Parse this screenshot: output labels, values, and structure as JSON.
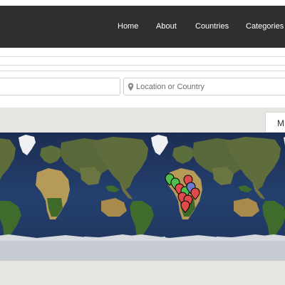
{
  "nav": {
    "items": [
      {
        "label": "Home"
      },
      {
        "label": "About"
      },
      {
        "label": "Countries"
      },
      {
        "label": "Categories"
      }
    ]
  },
  "search": {
    "location_placeholder": "Location or Country"
  },
  "map": {
    "tab_label": "M",
    "marker_colors": [
      "#4cc04a",
      "#e04a4a",
      "#6b7cc9"
    ]
  },
  "icons": {
    "location": "map-marker-icon"
  }
}
